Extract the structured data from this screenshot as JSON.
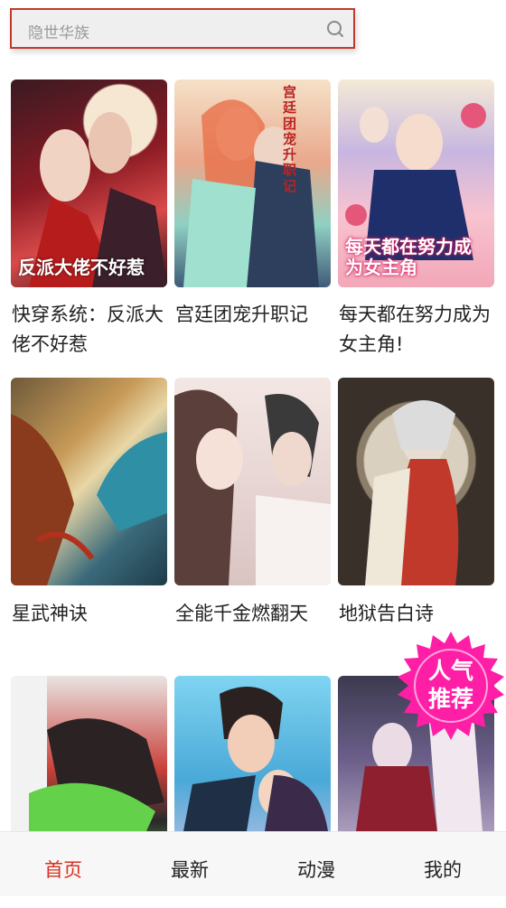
{
  "search": {
    "placeholder": "隐世华族"
  },
  "comics": [
    {
      "title": "快穿系统：反派大佬不好惹",
      "cover_text": "反派大佬不好惹"
    },
    {
      "title": "宫廷团宠升职记",
      "cover_text": "宫廷团宠升职记"
    },
    {
      "title": "每天都在努力成为女主角!",
      "cover_text": "每天都在努力成为女主角"
    },
    {
      "title": "星武神诀",
      "cover_text": ""
    },
    {
      "title": "全能千金燃翻天",
      "cover_text": ""
    },
    {
      "title": "地狱告白诗",
      "cover_text": ""
    },
    {
      "title": "",
      "cover_text": ""
    },
    {
      "title": "",
      "cover_text": ""
    },
    {
      "title": "",
      "cover_text": ""
    }
  ],
  "badge": {
    "line1": "人气",
    "line2": "推荐",
    "color": "#ff1fa6"
  },
  "tabs": [
    {
      "label": "首页",
      "active": true
    },
    {
      "label": "最新",
      "active": false
    },
    {
      "label": "动漫",
      "active": false
    },
    {
      "label": "我的",
      "active": false
    }
  ],
  "colors": {
    "accent": "#d9301f",
    "badge": "#ff1fa6"
  }
}
